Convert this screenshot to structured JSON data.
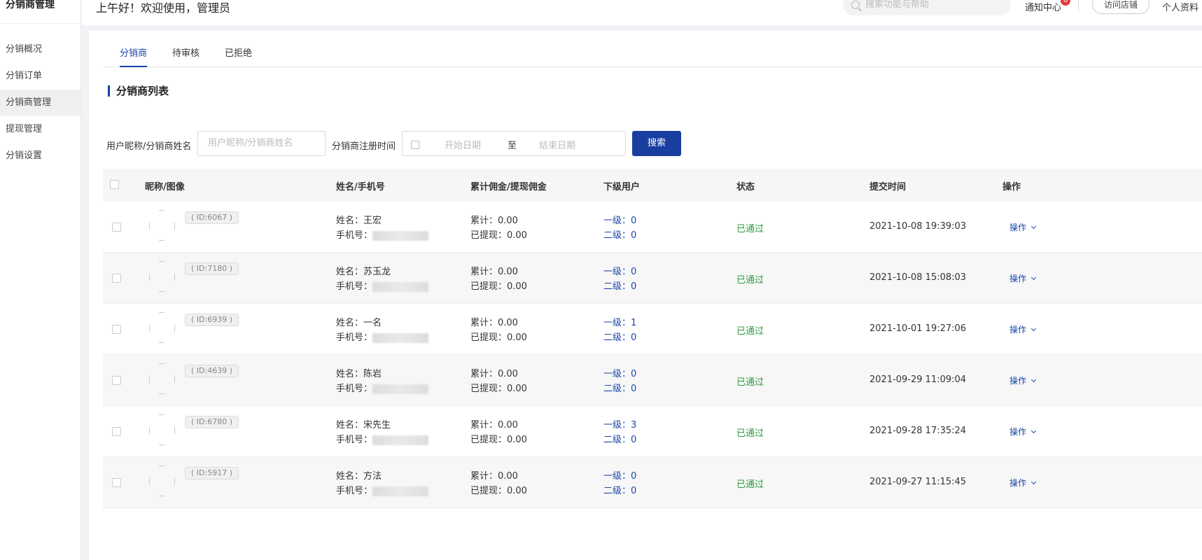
{
  "sidebar": {
    "title": "分销商管理",
    "items": [
      {
        "label": "分销概况"
      },
      {
        "label": "分销订单"
      },
      {
        "label": "分销商管理"
      },
      {
        "label": "提现管理"
      },
      {
        "label": "分销设置"
      }
    ]
  },
  "header": {
    "greeting": "上午好！欢迎使用，管理员",
    "search_placeholder": "搜索功能与帮助",
    "notify_label": "通知中心",
    "notify_count": "0",
    "visit_store": "访问店铺",
    "profile": "个人资料"
  },
  "tabs": [
    {
      "label": "分销商"
    },
    {
      "label": "待审核"
    },
    {
      "label": "已拒绝"
    }
  ],
  "section_title": "分销商列表",
  "filter": {
    "name_label": "用户昵称/分销商姓名",
    "name_placeholder": "用户昵称/分销商姓名",
    "date_label": "分销商注册时间",
    "start_placeholder": "开始日期",
    "separator": "至",
    "end_placeholder": "结束日期",
    "search_button": "搜索"
  },
  "table": {
    "headers": [
      "昵称/图像",
      "姓名/手机号",
      "累计佣金/提现佣金",
      "下级用户",
      "状态",
      "提交时间",
      "操作"
    ],
    "rows": [
      {
        "id": "( ID:6067 )",
        "name": "姓名：王宏",
        "phone": "手机号：",
        "total": "累计：0.00",
        "withdrawn": "已提现：0.00",
        "level1": "一级：0",
        "level2": "二级：0",
        "status": "已通过",
        "time": "2021-10-08 19:39:03",
        "op": "操作"
      },
      {
        "id": "( ID:7180 )",
        "name": "姓名：苏玉龙",
        "phone": "手机号：",
        "total": "累计：0.00",
        "withdrawn": "已提现：0.00",
        "level1": "一级：0",
        "level2": "二级：0",
        "status": "已通过",
        "time": "2021-10-08 15:08:03",
        "op": "操作"
      },
      {
        "id": "( ID:6939 )",
        "name": "姓名：一名",
        "phone": "手机号：",
        "total": "累计：0.00",
        "withdrawn": "已提现：0.00",
        "level1": "一级：1",
        "level2": "二级：0",
        "status": "已通过",
        "time": "2021-10-01 19:27:06",
        "op": "操作"
      },
      {
        "id": "( ID:4639 )",
        "name": "姓名：陈岩",
        "phone": "手机号：",
        "total": "累计：0.00",
        "withdrawn": "已提现：0.00",
        "level1": "一级：0",
        "level2": "二级：0",
        "status": "已通过",
        "time": "2021-09-29 11:09:04",
        "op": "操作"
      },
      {
        "id": "( ID:6780 )",
        "name": "姓名：宋先生",
        "phone": "手机号：",
        "total": "累计：0.00",
        "withdrawn": "已提现：0.00",
        "level1": "一级：3",
        "level2": "二级：0",
        "status": "已通过",
        "time": "2021-09-28 17:35:24",
        "op": "操作"
      },
      {
        "id": "( ID:5917 )",
        "name": "姓名：方法",
        "phone": "手机号：",
        "total": "累计：0.00",
        "withdrawn": "已提现：0.00",
        "level1": "一级：0",
        "level2": "二级：0",
        "status": "已通过",
        "time": "2021-09-27 11:15:45",
        "op": "操作"
      }
    ]
  },
  "colors": {
    "accent": "#1a46a8",
    "status_ok": "#2f9a3f",
    "badge": "#e4393c"
  }
}
